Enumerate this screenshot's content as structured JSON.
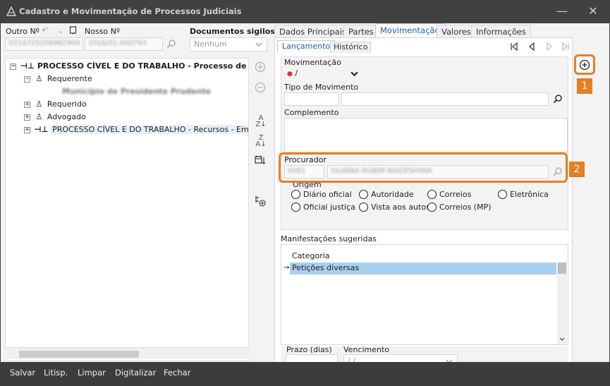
{
  "window": {
    "title": "Cadastro e Movimentação de Processos Judiciais",
    "minimize_glyph": "—",
    "close_glyph": "✕"
  },
  "top_fields": {
    "outro_label": "Outro Nº",
    "outro_value": "0214725209982904",
    "nosso_label": "Nosso Nº",
    "nosso_value": "2016/01.000793",
    "sigilosos_label": "Documentos sigilosos",
    "sigilosos_value": "Nenhum"
  },
  "tree": {
    "items": [
      {
        "label": "PROCESSO CÍVEL E DO TRABALHO - Processo de Conhecim"
      },
      {
        "label": "Requerente"
      },
      {
        "label": "Município de Presidente Prudente"
      },
      {
        "label": "Requerido"
      },
      {
        "label": "Advogado"
      },
      {
        "label": "PROCESSO CÍVEL E DO TRABALHO - Recursos - Embargo"
      }
    ]
  },
  "tabs": [
    {
      "label": "Dados Principais"
    },
    {
      "label": "Partes"
    },
    {
      "label": "Movimentação"
    },
    {
      "label": "Valores"
    },
    {
      "label": "Informações"
    }
  ],
  "subtabs": [
    {
      "label": "Lançamento"
    },
    {
      "label": "Histórico"
    }
  ],
  "form": {
    "movimentacao_label": "Movimentação",
    "movimentacao_value": "/",
    "tipo_label": "Tipo de Movimento",
    "complemento_label": "Complemento",
    "procurador_label": "Procurador",
    "procurador_code": "0001",
    "procurador_name": "SILVANA RUBIM BIAGESHIWA",
    "origem_label": "Origem",
    "origem_options": [
      {
        "label": "Diário oficial"
      },
      {
        "label": "Autoridade"
      },
      {
        "label": "Correios"
      },
      {
        "label": "Eletrônica"
      },
      {
        "label": "Oficial justiça"
      },
      {
        "label": "Vista aos autos"
      },
      {
        "label": "Correios (MP)"
      }
    ],
    "manifestacoes_label": "Manifestações sugeridas",
    "categoria_header": "Categoria",
    "categoria_row": "Petições diversas",
    "prazo_label": "Prazo (dias)",
    "vencimento_label": "Vencimento",
    "vencimento_value": " /  /"
  },
  "callouts": {
    "badge1": "1",
    "badge2": "2",
    "color": "#e67e22"
  },
  "bottom_buttons": [
    {
      "label": "Salvar"
    },
    {
      "label": "Litisp."
    },
    {
      "label": "Limpar"
    },
    {
      "label": "Digitalizar"
    },
    {
      "label": "Fechar"
    }
  ],
  "colors": {
    "accent": "#1a5fb4",
    "selection": "#a8d0f0",
    "title_bar": "#414141"
  }
}
